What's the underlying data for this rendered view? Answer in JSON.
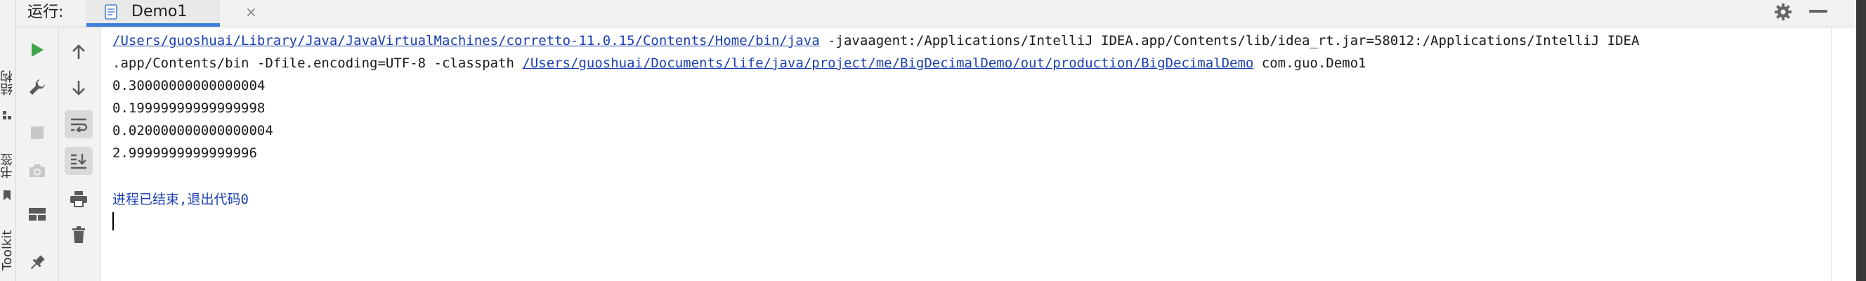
{
  "side_panel": {
    "structure_label": "结构",
    "bookmark_label": "书签",
    "toolkit_label": "Toolkit"
  },
  "header": {
    "run_label": "运行:",
    "tab_title": "Demo1",
    "tab_close": "×"
  },
  "toolbar": {
    "column_one": [
      "run-icon",
      "wrench-icon",
      "stop-icon",
      "camera-icon",
      "layout-icon",
      "pin-icon"
    ],
    "column_two": [
      "arrow-up-icon",
      "arrow-down-icon",
      "soft-wrap-icon",
      "scroll-to-end-icon",
      "print-icon",
      "trash-icon"
    ]
  },
  "console": {
    "command": {
      "java_path": "/Users/guoshuai/Library/Java/JavaVirtualMachines/corretto-11.0.15/Contents/Home/bin/java",
      "javaagent": " -javaagent:/Applications/IntelliJ IDEA.app/Contents/lib/idea_rt.jar=58012:/Applications/IntelliJ IDEA",
      "continuation": ".app/Contents/bin -Dfile.encoding=UTF-8 -classpath ",
      "classpath": "/Users/guoshuai/Documents/life/java/project/me/BigDecimalDemo/out/production/BigDecimalDemo",
      "main_class": " com.guo.Demo1"
    },
    "outputs": [
      "0.30000000000000004",
      "0.19999999999999998",
      "0.020000000000000004",
      "2.9999999999999996"
    ],
    "exit_message": "进程已结束,退出代码0"
  },
  "colors": {
    "link": "#1a3fb0",
    "run_green": "#3ea64a",
    "tab_underline": "#3d7ed8",
    "panel_background": "#f2f2f2"
  }
}
